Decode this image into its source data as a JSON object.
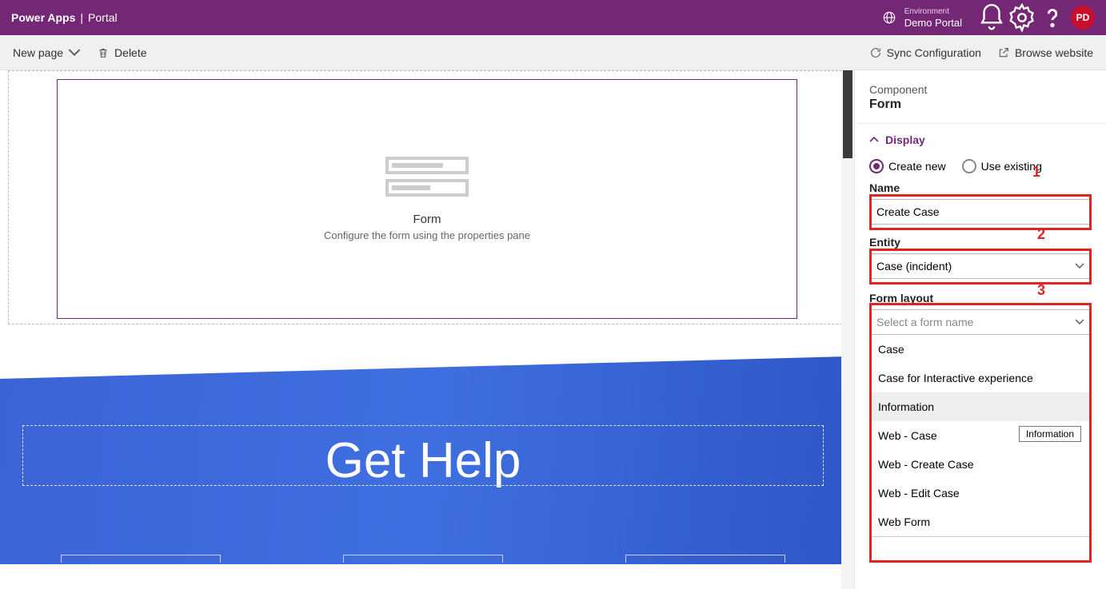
{
  "header": {
    "brand": "Power Apps",
    "divider": "|",
    "page": "Portal",
    "env_label": "Environment",
    "env_value": "Demo Portal",
    "avatar": "PD"
  },
  "cmdbar": {
    "new_page": "New page",
    "delete": "Delete",
    "sync": "Sync Configuration",
    "browse": "Browse website"
  },
  "canvas": {
    "form_title": "Form",
    "form_sub": "Configure the form using the properties pane",
    "hero_title": "Get Help"
  },
  "panel": {
    "component_lbl": "Component",
    "component_val": "Form",
    "display": "Display",
    "radio_create": "Create new",
    "radio_use": "Use existing",
    "name_lbl": "Name",
    "name_val": "Create Case",
    "entity_lbl": "Entity",
    "entity_val": "Case (incident)",
    "layout_lbl": "Form layout",
    "layout_ph": "Select a form name",
    "options": [
      "Case",
      "Case for Interactive experience",
      "Information",
      "Web - Case",
      "Web - Create Case",
      "Web - Edit Case",
      "Web Form"
    ],
    "hover_index": 2,
    "tooltip": "Information",
    "annot": {
      "1": "1",
      "2": "2",
      "3": "3"
    }
  }
}
